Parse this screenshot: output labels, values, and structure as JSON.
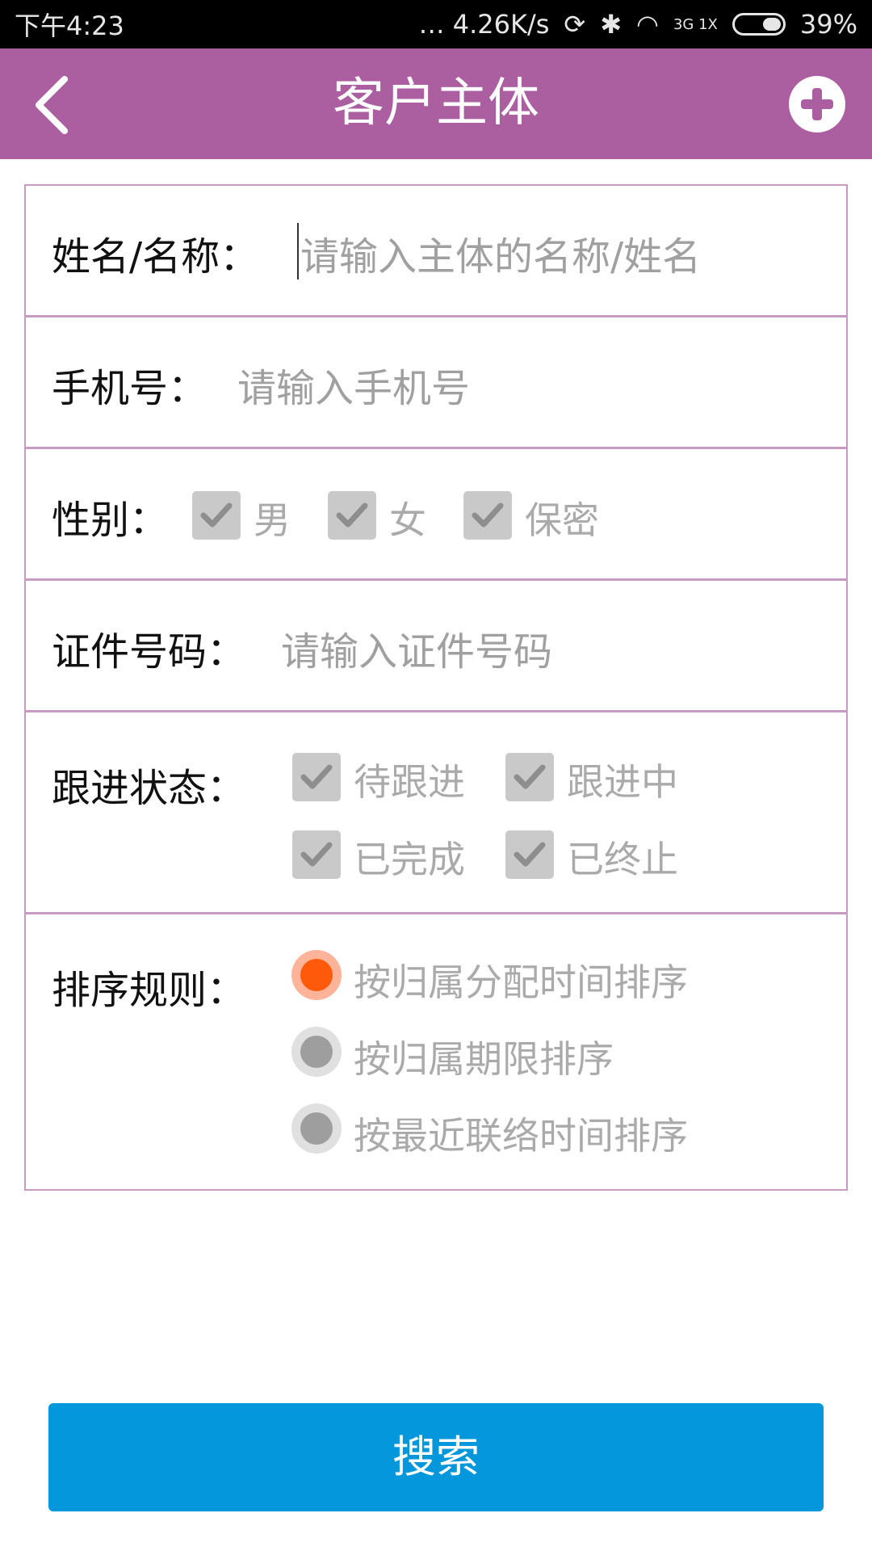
{
  "status_bar": {
    "time": "下午4:23",
    "speed": "… 4.26K/s",
    "network": "3G 1X",
    "battery": "39%",
    "battery_level": 0.39
  },
  "app_bar": {
    "title": "客户主体",
    "back_icon": "back-arrow-icon",
    "add_icon": "plus-circle-icon"
  },
  "form": {
    "name": {
      "label": "姓名/名称：",
      "placeholder": "请输入主体的名称/姓名"
    },
    "phone": {
      "label": "手机号：",
      "placeholder": "请输入手机号"
    },
    "gender": {
      "label": "性别：",
      "options": [
        {
          "label": "男",
          "checked": true
        },
        {
          "label": "女",
          "checked": true
        },
        {
          "label": "保密",
          "checked": true
        }
      ]
    },
    "id_number": {
      "label": "证件号码：",
      "placeholder": "请输入证件号码"
    },
    "follow_status": {
      "label": "跟进状态：",
      "options": [
        {
          "label": "待跟进",
          "checked": true
        },
        {
          "label": "跟进中",
          "checked": true
        },
        {
          "label": "已完成",
          "checked": true
        },
        {
          "label": "已终止",
          "checked": true
        }
      ]
    },
    "sort_rule": {
      "label": "排序规则：",
      "options": [
        {
          "label": "按归属分配时间排序",
          "selected": true
        },
        {
          "label": "按归属期限排序",
          "selected": false
        },
        {
          "label": "按最近联络时间排序",
          "selected": false
        }
      ]
    }
  },
  "search_button": {
    "label": "搜索"
  },
  "colors": {
    "app_bar": "#ab5fa1",
    "border": "#c79ac2",
    "search_button": "#0497db",
    "radio_selected": "#ff5a0a"
  }
}
